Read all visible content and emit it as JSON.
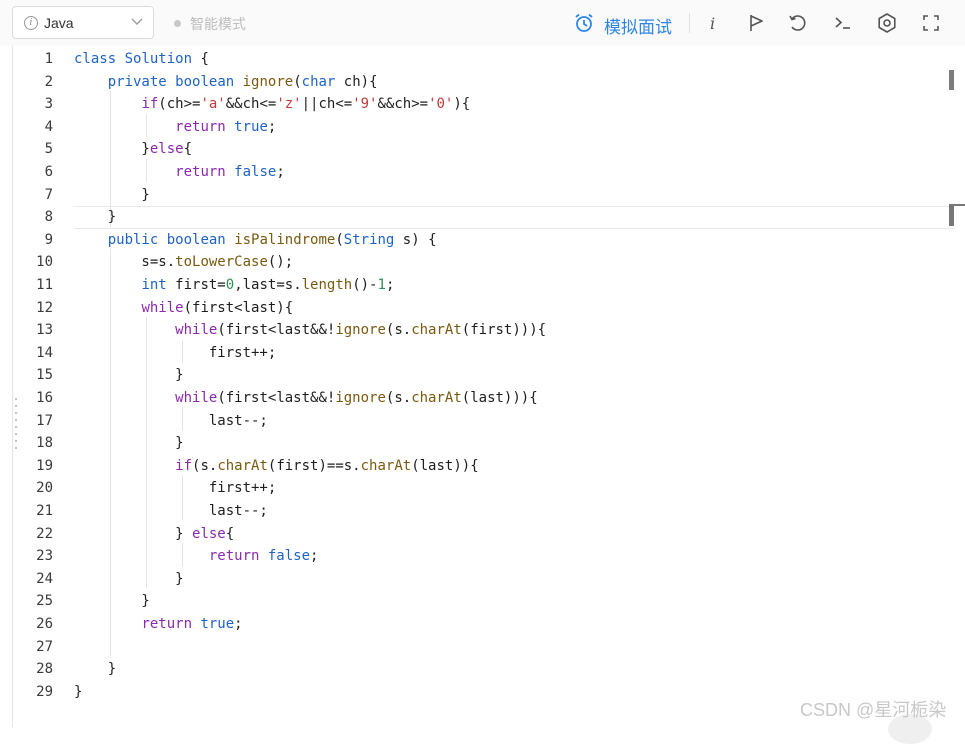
{
  "toolbar": {
    "language": "Java",
    "smart_mode": "智能模式",
    "mock_interview": "模拟面试",
    "icons": [
      "info-icon",
      "run-flag-icon",
      "reset-icon",
      "terminal-icon",
      "settings-icon",
      "fullscreen-icon"
    ]
  },
  "editor": {
    "line_numbers": [
      "1",
      "2",
      "3",
      "4",
      "5",
      "6",
      "7",
      "8",
      "9",
      "10",
      "11",
      "12",
      "13",
      "14",
      "15",
      "16",
      "17",
      "18",
      "19",
      "20",
      "21",
      "22",
      "23",
      "24",
      "25",
      "26",
      "27",
      "28",
      "29"
    ],
    "current_line": 8
  },
  "watermark": "CSDN @星河栀染",
  "colors": {
    "accent": "#2f86e6",
    "keyword": "#1e63c4",
    "control": "#8a2aae",
    "string": "#c33b3b",
    "number": "#2e8b57"
  }
}
